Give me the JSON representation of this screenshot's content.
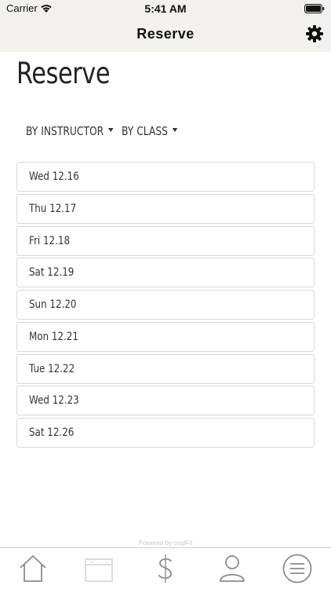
{
  "status_bar": {
    "carrier": "Carrier",
    "time": "5:41 AM",
    "icons": [
      "wifi-icon",
      "battery-icon"
    ]
  },
  "nav_bar": {
    "title": "Reserve",
    "right_icon": "gear-icon"
  },
  "page": {
    "title": "Reserve",
    "filters": [
      {
        "label": "BY INSTRUCTOR",
        "icon": "caret-down-icon"
      },
      {
        "label": "BY CLASS",
        "icon": "caret-down-icon"
      }
    ],
    "dates": [
      "Wed 12.16",
      "Thu 12.17",
      "Fri 12.18",
      "Sat 12.19",
      "Sun 12.20",
      "Mon 12.21",
      "Tue 12.22",
      "Wed 12.23",
      "Sat 12.26"
    ]
  },
  "footer": {
    "powered_by": "Powered by ooglFit"
  },
  "tab_bar": {
    "tabs": [
      {
        "icon": "home-icon",
        "active": false
      },
      {
        "icon": "schedule-icon",
        "active": true
      },
      {
        "icon": "dollar-icon",
        "active": false
      },
      {
        "icon": "person-icon",
        "active": false
      },
      {
        "icon": "menu-icon",
        "active": false
      }
    ]
  },
  "colors": {
    "header_bg": "#f2f1ee",
    "tab_icon": "#8c8c8c",
    "tab_icon_active": "#d9d9d9",
    "border": "#d7d7d7"
  }
}
